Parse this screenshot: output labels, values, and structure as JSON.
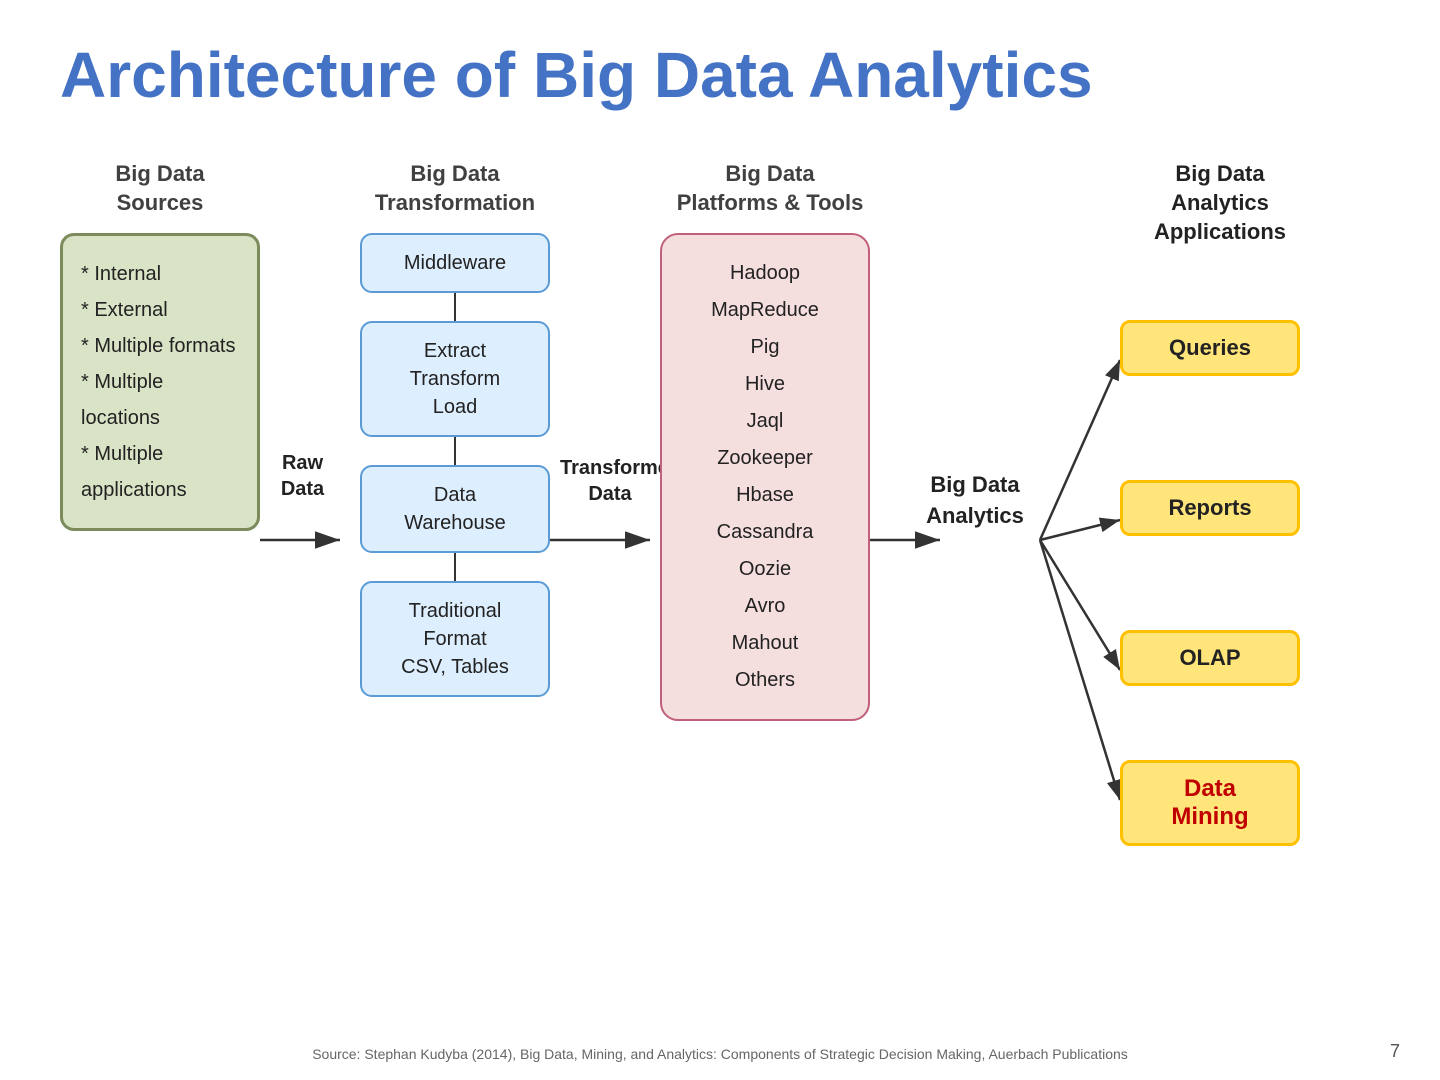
{
  "title": "Architecture of Big Data Analytics",
  "columns": {
    "sources": {
      "header_line1": "Big Data",
      "header_line2": "Sources",
      "items": [
        "* Internal",
        "* External",
        "* Multiple formats",
        "* Multiple locations",
        "* Multiple applications"
      ]
    },
    "transformation": {
      "header_line1": "Big Data",
      "header_line2": "Transformation",
      "boxes": [
        {
          "label": "Middleware"
        },
        {
          "label": "Extract\nTransform\nLoad"
        },
        {
          "label": "Data\nWarehouse"
        },
        {
          "label": "Traditional\nFormat\nCSV, Tables"
        }
      ]
    },
    "platforms": {
      "header_line1": "Big Data",
      "header_line2": "Platforms & Tools",
      "items": [
        "Hadoop",
        "MapReduce",
        "Pig",
        "Hive",
        "Jaql",
        "Zookeeper",
        "Hbase",
        "Cassandra",
        "Oozie",
        "Avro",
        "Mahout",
        "Others"
      ]
    },
    "analytics": {
      "label_line1": "Big Data",
      "label_line2": "Analytics"
    },
    "applications": {
      "header_line1": "Big Data",
      "header_line2": "Analytics",
      "header_line3": "Applications",
      "items": [
        {
          "label": "Queries",
          "special": false
        },
        {
          "label": "Reports",
          "special": false
        },
        {
          "label": "OLAP",
          "special": false
        },
        {
          "label": "Data\nMining",
          "special": true
        }
      ]
    }
  },
  "arrows": {
    "raw_data_line1": "Raw",
    "raw_data_line2": "Data",
    "transformed_line1": "Transformed",
    "transformed_line2": "Data"
  },
  "footer": {
    "text": "Source: Stephan Kudyba (2014), Big Data, Mining, and Analytics: Components of Strategic Decision Making, Auerbach Publications",
    "page": "7"
  }
}
